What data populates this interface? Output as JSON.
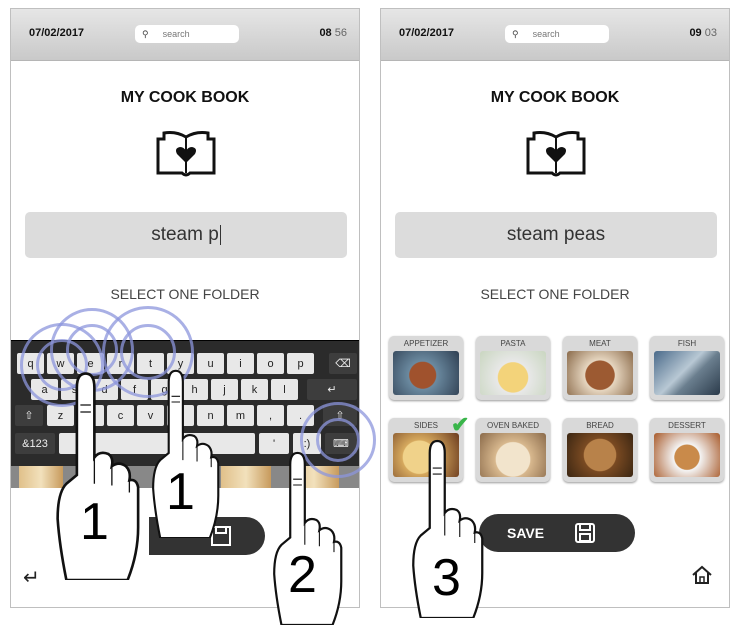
{
  "screens": [
    {
      "date": "07/02/2017",
      "search_placeholder": "search",
      "time_hours": "08",
      "time_minutes": "56",
      "title": "MY COOK BOOK",
      "recipe_name": "steam p",
      "select_label": "SELECT ONE FOLDER",
      "keyboard": {
        "row1": [
          "q",
          "w",
          "e",
          "r",
          "t",
          "y",
          "u",
          "i",
          "o",
          "p"
        ],
        "row2": [
          "a",
          "s",
          "d",
          "f",
          "g",
          "h",
          "j",
          "k",
          "l"
        ],
        "row3": [
          "z",
          "x",
          "c",
          "v",
          "b",
          "n",
          "m",
          ",",
          "."
        ],
        "symbols_key": "&123"
      },
      "step_numbers": [
        "1",
        "1",
        "2"
      ]
    },
    {
      "date": "07/02/2017",
      "search_placeholder": "search",
      "time_hours": "09",
      "time_minutes": "03",
      "title": "MY COOK BOOK",
      "recipe_name": "steam peas",
      "select_label": "SELECT ONE FOLDER",
      "folders": [
        "APPETIZER",
        "PASTA",
        "MEAT",
        "FISH",
        "SIDES",
        "OVEN BAKED",
        "BREAD",
        "DESSERT"
      ],
      "selected_folder": "SIDES",
      "save_label": "SAVE",
      "step_number": "3"
    }
  ],
  "colors": {
    "ring": "#8c96dc",
    "check": "#39b54a",
    "save_bg": "#333333"
  }
}
